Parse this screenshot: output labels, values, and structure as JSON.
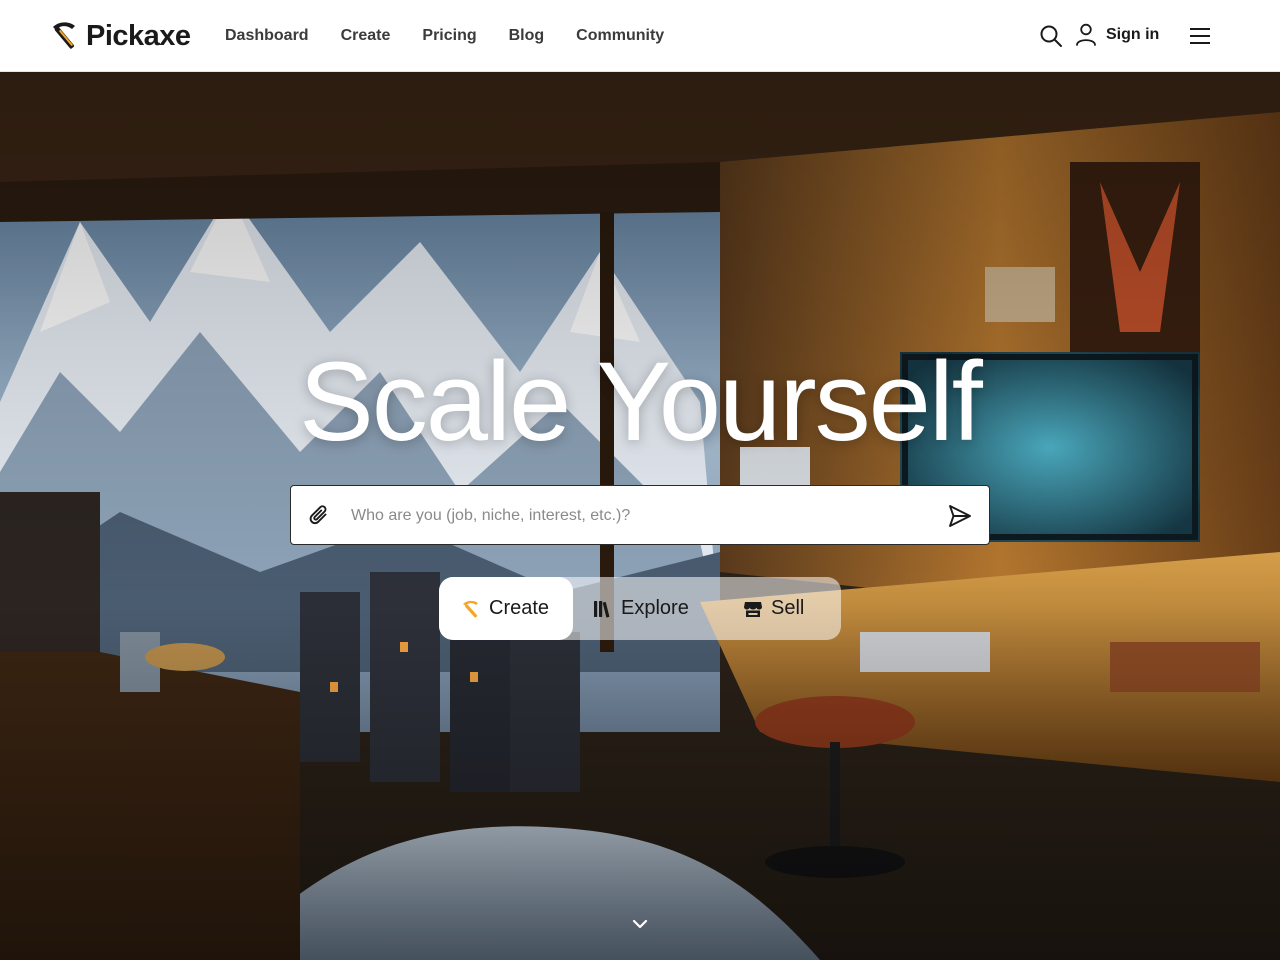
{
  "header": {
    "logo_text": "Pickaxe",
    "logo_icon": "pickaxe-icon",
    "nav": [
      {
        "label": "Dashboard"
      },
      {
        "label": "Create"
      },
      {
        "label": "Pricing"
      },
      {
        "label": "Blog"
      },
      {
        "label": "Community"
      }
    ],
    "search_icon": "search-icon",
    "user_icon": "user-icon",
    "signin_label": "Sign in",
    "menu_icon": "hamburger-menu-icon"
  },
  "hero": {
    "title": "Scale Yourself",
    "prompt": {
      "placeholder": "Who are you (job, niche, interest, etc.)?",
      "value": "",
      "attach_icon": "paperclip-icon",
      "send_icon": "send-icon"
    },
    "modes": [
      {
        "label": "Create",
        "icon": "pickaxe-icon",
        "active": true
      },
      {
        "label": "Explore",
        "icon": "library-icon",
        "active": false
      },
      {
        "label": "Sell",
        "icon": "store-icon",
        "active": false
      }
    ],
    "scroll_icon": "chevron-down-icon"
  },
  "colors": {
    "header_bg": "#ffffff",
    "text_dark": "#1a1a1a",
    "nav_text": "#3b3b3b",
    "accent_yellow": "#f5a623",
    "hero_title": "#ffffff"
  }
}
